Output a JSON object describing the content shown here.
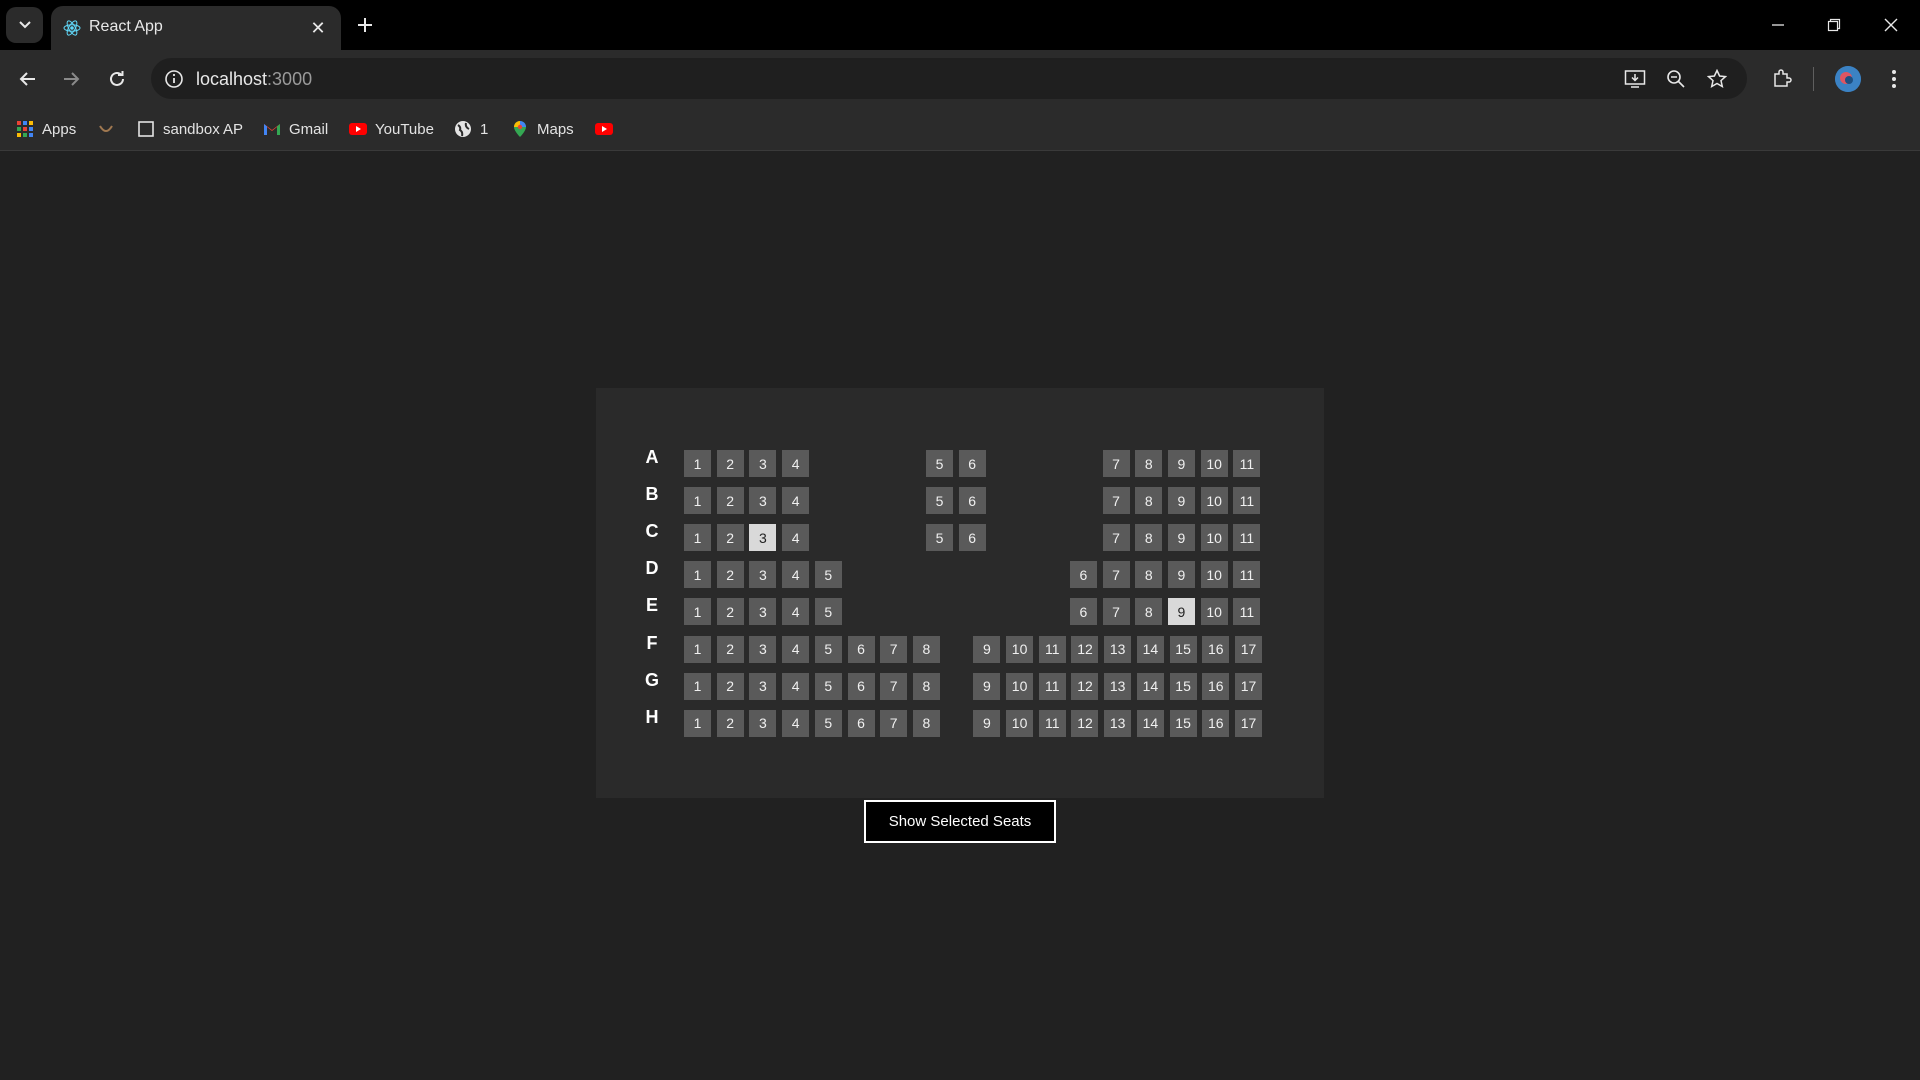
{
  "browser": {
    "tab_title": "React App",
    "url_host": "localhost",
    "url_port": ":3000",
    "bookmarks": [
      {
        "label": "Apps",
        "icon": "apps-grid-icon"
      },
      {
        "label": "",
        "icon": "smile-icon"
      },
      {
        "label": "sandbox AP",
        "icon": "page-icon"
      },
      {
        "label": "Gmail",
        "icon": "gmail-icon"
      },
      {
        "label": "YouTube",
        "icon": "youtube-icon"
      },
      {
        "label": "1",
        "icon": "globe-icon"
      },
      {
        "label": "Maps",
        "icon": "maps-pin-icon"
      },
      {
        "label": "",
        "icon": "youtube-icon"
      }
    ]
  },
  "seating": {
    "rows": [
      {
        "label": "A",
        "groups": [
          [
            "1",
            "2",
            "3",
            "4"
          ],
          [
            "5",
            "6"
          ],
          [
            "7",
            "8",
            "9",
            "10",
            "11"
          ]
        ],
        "selected": []
      },
      {
        "label": "B",
        "groups": [
          [
            "1",
            "2",
            "3",
            "4"
          ],
          [
            "5",
            "6"
          ],
          [
            "7",
            "8",
            "9",
            "10",
            "11"
          ]
        ],
        "selected": []
      },
      {
        "label": "C",
        "groups": [
          [
            "1",
            "2",
            "3",
            "4"
          ],
          [
            "5",
            "6"
          ],
          [
            "7",
            "8",
            "9",
            "10",
            "11"
          ]
        ],
        "selected": [
          "3"
        ]
      },
      {
        "label": "D",
        "groups": [
          [
            "1",
            "2",
            "3",
            "4",
            "5"
          ],
          [],
          [
            "6",
            "7",
            "8",
            "9",
            "10",
            "11"
          ]
        ],
        "selected": []
      },
      {
        "label": "E",
        "groups": [
          [
            "1",
            "2",
            "3",
            "4",
            "5"
          ],
          [],
          [
            "6",
            "7",
            "8",
            "9",
            "10",
            "11"
          ]
        ],
        "selected": [
          "9"
        ]
      },
      {
        "label": "F",
        "groups": [
          [
            "1",
            "2",
            "3",
            "4",
            "5",
            "6",
            "7",
            "8"
          ],
          [
            "9",
            "10",
            "11",
            "12",
            "13",
            "14",
            "15",
            "16",
            "17"
          ]
        ],
        "selected": []
      },
      {
        "label": "G",
        "groups": [
          [
            "1",
            "2",
            "3",
            "4",
            "5",
            "6",
            "7",
            "8"
          ],
          [
            "9",
            "10",
            "11",
            "12",
            "13",
            "14",
            "15",
            "16",
            "17"
          ]
        ],
        "selected": []
      },
      {
        "label": "H",
        "groups": [
          [
            "1",
            "2",
            "3",
            "4",
            "5",
            "6",
            "7",
            "8"
          ],
          [
            "9",
            "10",
            "11",
            "12",
            "13",
            "14",
            "15",
            "16",
            "17"
          ]
        ],
        "selected": []
      }
    ],
    "button_label": "Show Selected Seats"
  },
  "colors": {
    "seat": "#5a5a5a",
    "seat_selected": "#d9d9d9",
    "panel": "#2a2a2a",
    "page": "#212121"
  }
}
